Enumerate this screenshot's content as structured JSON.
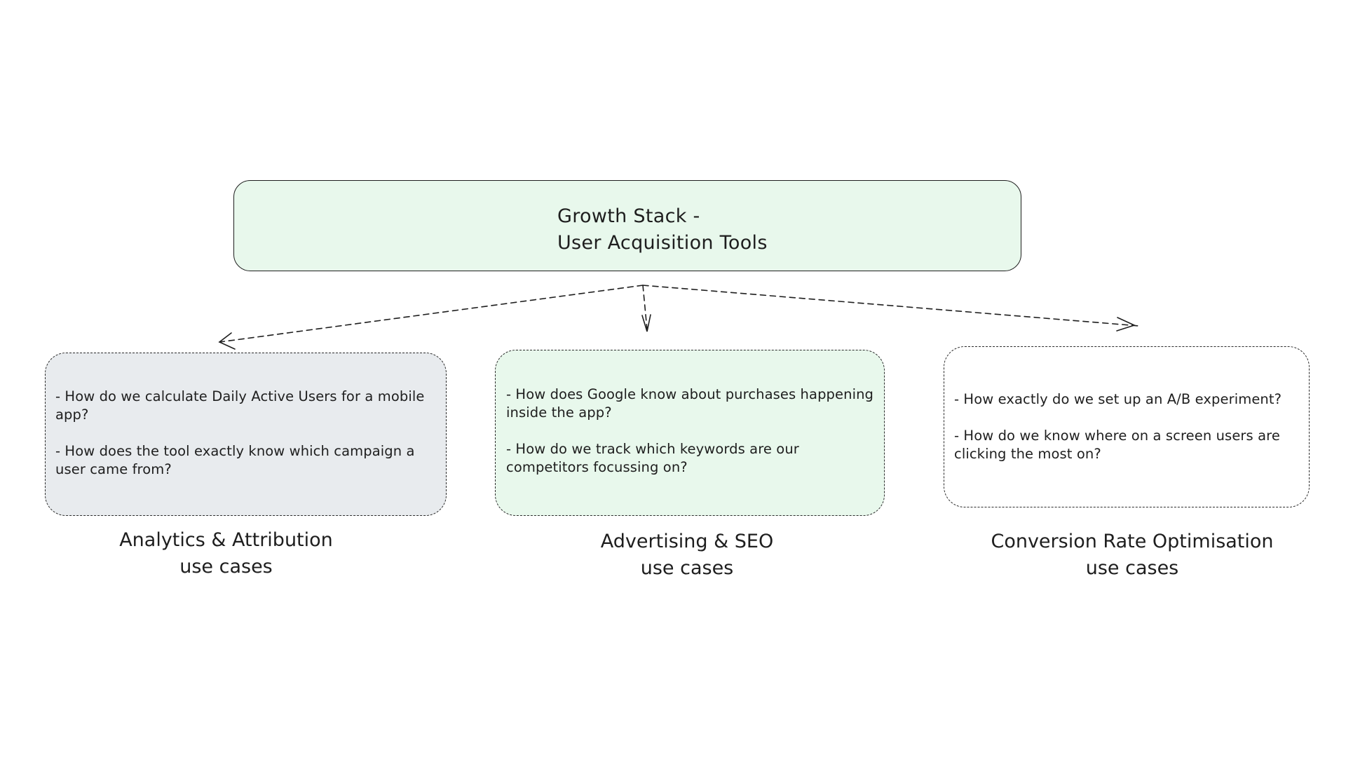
{
  "root": {
    "title_line1": "Growth Stack -",
    "title_line2": "User Acquisition Tools",
    "fill": "#e8f8ec"
  },
  "categories": [
    {
      "label_line1": "Analytics & Attribution",
      "label_line2": "use cases",
      "fill": "#e8ebee",
      "questions": [
        "- How do we calculate Daily Active Users for a mobile app?",
        "- How does the tool exactly know which campaign a user came from?"
      ]
    },
    {
      "label_line1": "Advertising & SEO",
      "label_line2": "use cases",
      "fill": "#e8f8ec",
      "questions": [
        "- How does Google know about purchases happening inside the app?",
        "- How do we track which keywords are our competitors focussing on?"
      ]
    },
    {
      "label_line1": "Conversion Rate Optimisation",
      "label_line2": "use cases",
      "fill": "#ffffff",
      "questions": [
        "- How exactly do we set up an A/B experiment?",
        "- How do we know where on a screen users are clicking the most on?"
      ]
    }
  ],
  "edges": [
    {
      "from": "root",
      "to": "Analytics & Attribution",
      "style": "dashed-arrow"
    },
    {
      "from": "root",
      "to": "Advertising & SEO",
      "style": "dashed-arrow"
    },
    {
      "from": "root",
      "to": "Conversion Rate Optimisation",
      "style": "dashed-arrow"
    }
  ]
}
